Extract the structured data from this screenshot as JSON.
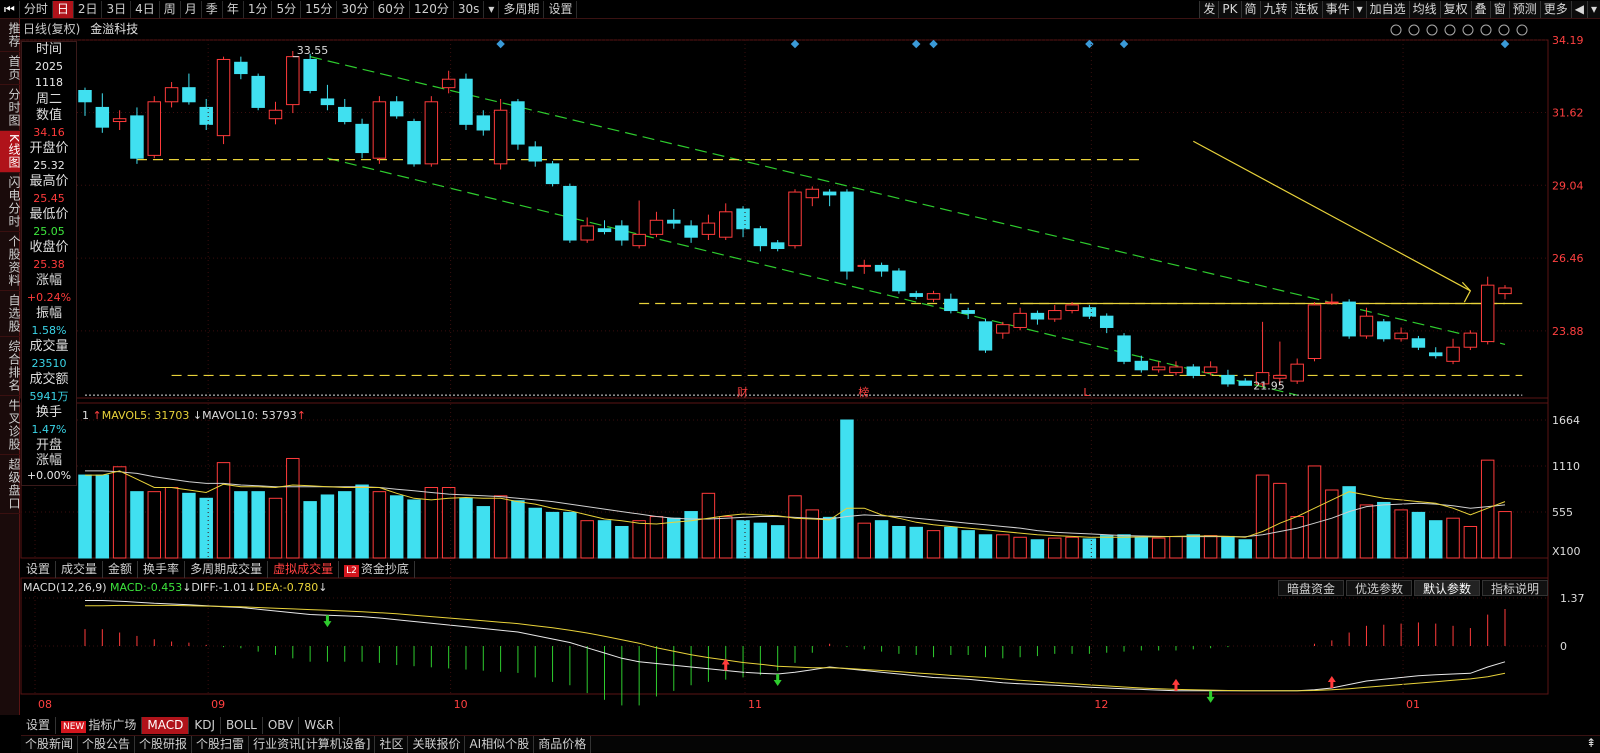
{
  "toolbar": {
    "left": [
      "分时",
      "日",
      "2日",
      "3日",
      "4日",
      "周",
      "月",
      "季",
      "年",
      "1分",
      "5分",
      "15分",
      "30分",
      "60分",
      "120分",
      "30s",
      "多周期",
      "设置"
    ],
    "active": "日",
    "right": [
      "发",
      "PK",
      "简",
      "九转",
      "连板",
      "事件",
      "加自选",
      "均线",
      "复权",
      "叠",
      "窗",
      "预测",
      "更多"
    ]
  },
  "sidebar": [
    "推荐",
    "首页",
    "分时图",
    "K线图",
    "闪电分时",
    "个股资料",
    "自选股",
    "综合排名",
    "牛叉诊股",
    "超级盘口"
  ],
  "sidebar_active": "K线图",
  "chart_header": {
    "mode": "日线(复权)",
    "stock": "金溢科技"
  },
  "info": {
    "time_label": "时间",
    "year": "2025",
    "date": "1118",
    "weekday": "周二",
    "value_label": "数值",
    "value": "34.16",
    "open_label": "开盘价",
    "open": "25.32",
    "high_label": "最高价",
    "high": "25.45",
    "low_label": "最低价",
    "low": "25.05",
    "close_label": "收盘价",
    "close": "25.38",
    "change_label": "涨幅",
    "change": "+0.24%",
    "amplitude_label": "振幅",
    "amplitude": "1.58%",
    "volume_label": "成交量",
    "volume": "23510",
    "turnover_label": "成交额",
    "turnover": "5941万",
    "turnover_rate_label": "换手",
    "turnover_rate": "1.47%",
    "open_change_label": "开盘涨幅",
    "open_change": "+0.00%"
  },
  "price_axis": [
    "34.19",
    "31.62",
    "29.04",
    "26.46",
    "23.88"
  ],
  "annotations": {
    "high": "33.55",
    "low": "21.95",
    "markers": [
      "财",
      "榜",
      "L"
    ]
  },
  "volume_header": {
    "prefix": "1",
    "ma5_label": "MAVOL5:",
    "ma5": "31703",
    "ma10_label": "MAVOL10:",
    "ma10": "53793"
  },
  "volume_axis": [
    "1664",
    "1110",
    "555",
    "X100"
  ],
  "volume_tabs": [
    "设置",
    "成交量",
    "金额",
    "换手率",
    "多周期成交量",
    "虚拟成交量",
    "资金抄底"
  ],
  "volume_tab_active": "虚拟成交量",
  "macd_header": {
    "name": "MACD(12,26,9)",
    "macd_label": "MACD:",
    "macd": "-0.453",
    "diff_label": "DIFF:",
    "diff": "-1.01",
    "dea_label": "DEA:",
    "dea": "-0.780"
  },
  "macd_axis": [
    "1.37",
    "0"
  ],
  "macd_buttons": [
    "暗盘资金",
    "优选参数",
    "默认参数",
    "指标说明"
  ],
  "macd_button_active": "默认参数",
  "time_axis": [
    "08",
    "09",
    "10",
    "11",
    "12",
    "01"
  ],
  "indicator_tabs": [
    "设置",
    "指标广场",
    "MACD",
    "KDJ",
    "BOLL",
    "OBV",
    "W&R"
  ],
  "indicator_tab_active": "MACD",
  "indicator_new_badge": "NEW",
  "bottom_tabs": [
    "个股新闻",
    "个股公告",
    "个股研报",
    "个股扫雷",
    "行业资讯[计算机设备]",
    "社区",
    "关联报价",
    "AI相似个股",
    "商品价格"
  ],
  "colors": {
    "up": "#ff3b3b",
    "down": "#40e0f0",
    "ma5": "#e8d23a",
    "ma10": "#d0d0d0",
    "trend_green": "#2ecc2e",
    "trend_yellow": "#e8d23a"
  },
  "chart_data": {
    "type": "candlestick",
    "price_range": [
      21.5,
      34.19
    ],
    "candles": [
      [
        32.4,
        32.0,
        32.5,
        31.5
      ],
      [
        31.8,
        31.1,
        32.3,
        30.9
      ],
      [
        31.3,
        31.4,
        31.7,
        31.0
      ],
      [
        31.5,
        30.0,
        31.8,
        29.8
      ],
      [
        30.1,
        32.0,
        32.2,
        30.0
      ],
      [
        32.0,
        32.5,
        32.7,
        31.8
      ],
      [
        32.5,
        32.0,
        33.0,
        31.9
      ],
      [
        31.8,
        31.2,
        32.1,
        31.0
      ],
      [
        30.8,
        33.5,
        33.6,
        30.5
      ],
      [
        33.4,
        33.0,
        33.6,
        32.8
      ],
      [
        32.9,
        31.8,
        33.0,
        31.7
      ],
      [
        31.4,
        31.7,
        32.0,
        31.2
      ],
      [
        31.9,
        33.6,
        33.8,
        31.6
      ],
      [
        33.5,
        32.4,
        33.7,
        32.3
      ],
      [
        32.1,
        31.9,
        32.6,
        31.7
      ],
      [
        31.8,
        31.3,
        32.1,
        31.2
      ],
      [
        31.2,
        30.2,
        31.4,
        30.0
      ],
      [
        30.0,
        32.0,
        32.2,
        29.8
      ],
      [
        32.0,
        31.5,
        32.2,
        31.4
      ],
      [
        31.3,
        29.8,
        31.4,
        29.7
      ],
      [
        29.8,
        32.0,
        32.2,
        29.7
      ],
      [
        32.5,
        32.8,
        33.1,
        32.3
      ],
      [
        32.8,
        31.2,
        33.0,
        31.0
      ],
      [
        31.5,
        31.0,
        31.7,
        30.8
      ],
      [
        29.8,
        31.7,
        32.1,
        29.6
      ],
      [
        32.0,
        30.5,
        32.1,
        30.3
      ],
      [
        30.4,
        29.9,
        30.6,
        29.7
      ],
      [
        29.8,
        29.1,
        29.9,
        29.0
      ],
      [
        29.0,
        27.1,
        29.1,
        27.0
      ],
      [
        27.1,
        27.6,
        27.9,
        27.0
      ],
      [
        27.5,
        27.4,
        27.8,
        27.3
      ],
      [
        27.6,
        27.1,
        27.8,
        26.9
      ],
      [
        26.9,
        27.3,
        28.5,
        26.8
      ],
      [
        27.3,
        27.8,
        28.1,
        27.2
      ],
      [
        27.8,
        27.7,
        28.2,
        27.5
      ],
      [
        27.6,
        27.2,
        27.8,
        27.0
      ],
      [
        27.3,
        27.7,
        28.0,
        27.1
      ],
      [
        27.2,
        28.1,
        28.4,
        27.1
      ],
      [
        28.2,
        27.5,
        28.3,
        27.2
      ],
      [
        27.5,
        26.9,
        27.6,
        26.7
      ],
      [
        27.0,
        26.8,
        27.1,
        26.7
      ],
      [
        26.9,
        28.8,
        28.9,
        26.8
      ],
      [
        28.6,
        28.9,
        29.0,
        28.3
      ],
      [
        28.8,
        28.7,
        28.9,
        28.3
      ],
      [
        28.8,
        26.0,
        28.9,
        25.7
      ],
      [
        26.2,
        26.2,
        26.4,
        25.9
      ],
      [
        26.2,
        26.0,
        26.3,
        25.8
      ],
      [
        26.0,
        25.3,
        26.1,
        25.2
      ],
      [
        25.2,
        25.1,
        25.3,
        25.0
      ],
      [
        25.0,
        25.2,
        25.3,
        24.9
      ],
      [
        25.0,
        24.6,
        25.2,
        24.5
      ],
      [
        24.6,
        24.5,
        24.7,
        24.3
      ],
      [
        24.2,
        23.2,
        24.3,
        23.1
      ],
      [
        23.8,
        24.1,
        24.2,
        23.6
      ],
      [
        24.0,
        24.5,
        24.7,
        23.9
      ],
      [
        24.5,
        24.3,
        24.6,
        24.1
      ],
      [
        24.3,
        24.6,
        24.8,
        24.2
      ],
      [
        24.6,
        24.8,
        24.9,
        24.5
      ],
      [
        24.7,
        24.4,
        24.8,
        24.3
      ],
      [
        24.4,
        24.0,
        24.5,
        23.8
      ],
      [
        23.7,
        22.8,
        23.8,
        22.7
      ],
      [
        22.8,
        22.5,
        23.0,
        22.4
      ],
      [
        22.5,
        22.6,
        22.8,
        22.4
      ],
      [
        22.4,
        22.6,
        22.8,
        22.3
      ],
      [
        22.6,
        22.3,
        22.7,
        22.2
      ],
      [
        22.4,
        22.6,
        22.8,
        22.3
      ],
      [
        22.3,
        22.0,
        22.5,
        21.9
      ],
      [
        22.1,
        21.95,
        22.2,
        21.95
      ],
      [
        22.0,
        22.4,
        24.2,
        21.9
      ],
      [
        22.2,
        22.3,
        23.5,
        21.95
      ],
      [
        22.1,
        22.7,
        22.9,
        22.0
      ],
      [
        22.9,
        24.8,
        24.9,
        22.8
      ],
      [
        24.9,
        24.9,
        25.2,
        24.8
      ],
      [
        24.9,
        23.7,
        25.0,
        23.6
      ],
      [
        23.7,
        24.4,
        24.7,
        23.6
      ],
      [
        24.2,
        23.6,
        24.3,
        23.5
      ],
      [
        23.6,
        23.8,
        24.0,
        23.5
      ],
      [
        23.6,
        23.3,
        23.7,
        23.2
      ],
      [
        23.1,
        23.0,
        23.3,
        22.9
      ],
      [
        22.8,
        23.3,
        23.6,
        22.7
      ],
      [
        23.3,
        23.8,
        23.9,
        23.2
      ],
      [
        23.5,
        25.5,
        25.8,
        23.4
      ],
      [
        25.2,
        25.4,
        25.5,
        25.0
      ]
    ],
    "volumes": [
      1000,
      1000,
      1100,
      800,
      800,
      850,
      780,
      720,
      1150,
      800,
      800,
      720,
      1200,
      680,
      760,
      800,
      880,
      800,
      750,
      700,
      850,
      850,
      720,
      620,
      750,
      690,
      600,
      550,
      550,
      450,
      450,
      380,
      450,
      500,
      480,
      560,
      780,
      500,
      450,
      420,
      390,
      750,
      580,
      490,
      1664,
      420,
      450,
      380,
      370,
      330,
      370,
      330,
      280,
      280,
      250,
      220,
      240,
      250,
      230,
      270,
      280,
      250,
      240,
      260,
      280,
      270,
      260,
      220,
      1000,
      900,
      500,
      1110,
      820,
      860,
      640,
      670,
      580,
      550,
      450,
      480,
      380,
      1180,
      560
    ],
    "ma5": [
      1000,
      1000,
      1050,
      950,
      850,
      850,
      820,
      790,
      890,
      860,
      860,
      850,
      880,
      870,
      860,
      850,
      850,
      850,
      780,
      720,
      700,
      720,
      730,
      720,
      720,
      680,
      650,
      600,
      570,
      520,
      470,
      450,
      420,
      410,
      430,
      450,
      480,
      510,
      530,
      520,
      510,
      480,
      470,
      460,
      600,
      600,
      520,
      480,
      430,
      400,
      380,
      360,
      340,
      320,
      300,
      280,
      270,
      260,
      250,
      250,
      250,
      255,
      255,
      260,
      265,
      265,
      260,
      250,
      320,
      420,
      500,
      600,
      700,
      800,
      760,
      720,
      700,
      680,
      660,
      600,
      520,
      600,
      680
    ],
    "ma10": [
      1050,
      1050,
      1040,
      1020,
      980,
      950,
      920,
      900,
      900,
      880,
      870,
      860,
      860,
      860,
      860,
      860,
      860,
      850,
      830,
      810,
      790,
      770,
      760,
      750,
      740,
      720,
      700,
      680,
      650,
      620,
      590,
      560,
      530,
      500,
      480,
      470,
      470,
      480,
      490,
      500,
      500,
      490,
      480,
      470,
      500,
      520,
      510,
      500,
      480,
      460,
      440,
      420,
      400,
      380,
      360,
      330,
      310,
      300,
      290,
      280,
      270,
      265,
      260,
      258,
      258,
      258,
      258,
      256,
      280,
      320,
      360,
      420,
      480,
      560,
      620,
      640,
      650,
      660,
      650,
      630,
      600,
      620,
      640
    ],
    "macd": {
      "diff": [
        1.3,
        1.3,
        1.28,
        1.25,
        1.22,
        1.2,
        1.18,
        1.15,
        1.12,
        1.1,
        1.05,
        1.0,
        0.95,
        0.9,
        0.88,
        0.86,
        0.84,
        0.8,
        0.75,
        0.7,
        0.65,
        0.6,
        0.55,
        0.5,
        0.45,
        0.4,
        0.3,
        0.2,
        0.1,
        -0.05,
        -0.2,
        -0.35,
        -0.45,
        -0.5,
        -0.55,
        -0.6,
        -0.65,
        -0.7,
        -0.75,
        -0.78,
        -0.8,
        -0.75,
        -0.68,
        -0.6,
        -0.65,
        -0.7,
        -0.75,
        -0.8,
        -0.85,
        -0.9,
        -0.92,
        -0.95,
        -1.0,
        -1.05,
        -1.08,
        -1.1,
        -1.12,
        -1.15,
        -1.18,
        -1.2,
        -1.22,
        -1.24,
        -1.26,
        -1.28,
        -1.28,
        -1.28,
        -1.28,
        -1.28,
        -1.28,
        -1.28,
        -1.28,
        -1.25,
        -1.2,
        -1.1,
        -1.0,
        -0.95,
        -0.9,
        -0.85,
        -0.82,
        -0.8,
        -0.78,
        -0.6,
        -0.45
      ],
      "dea": [
        1.15,
        1.15,
        1.16,
        1.16,
        1.16,
        1.16,
        1.15,
        1.14,
        1.13,
        1.12,
        1.1,
        1.08,
        1.06,
        1.04,
        1.02,
        1.0,
        0.98,
        0.95,
        0.92,
        0.88,
        0.84,
        0.8,
        0.76,
        0.72,
        0.68,
        0.64,
        0.58,
        0.52,
        0.45,
        0.37,
        0.28,
        0.18,
        0.08,
        -0.05,
        -0.15,
        -0.25,
        -0.33,
        -0.4,
        -0.47,
        -0.52,
        -0.58,
        -0.6,
        -0.62,
        -0.62,
        -0.64,
        -0.67,
        -0.7,
        -0.73,
        -0.77,
        -0.8,
        -0.84,
        -0.87,
        -0.9,
        -0.94,
        -0.98,
        -1.01,
        -1.05,
        -1.08,
        -1.11,
        -1.14,
        -1.17,
        -1.2,
        -1.22,
        -1.24,
        -1.25,
        -1.26,
        -1.27,
        -1.28,
        -1.28,
        -1.28,
        -1.28,
        -1.27,
        -1.25,
        -1.22,
        -1.18,
        -1.14,
        -1.1,
        -1.06,
        -1.02,
        -0.98,
        -0.94,
        -0.88,
        -0.78
      ]
    }
  }
}
